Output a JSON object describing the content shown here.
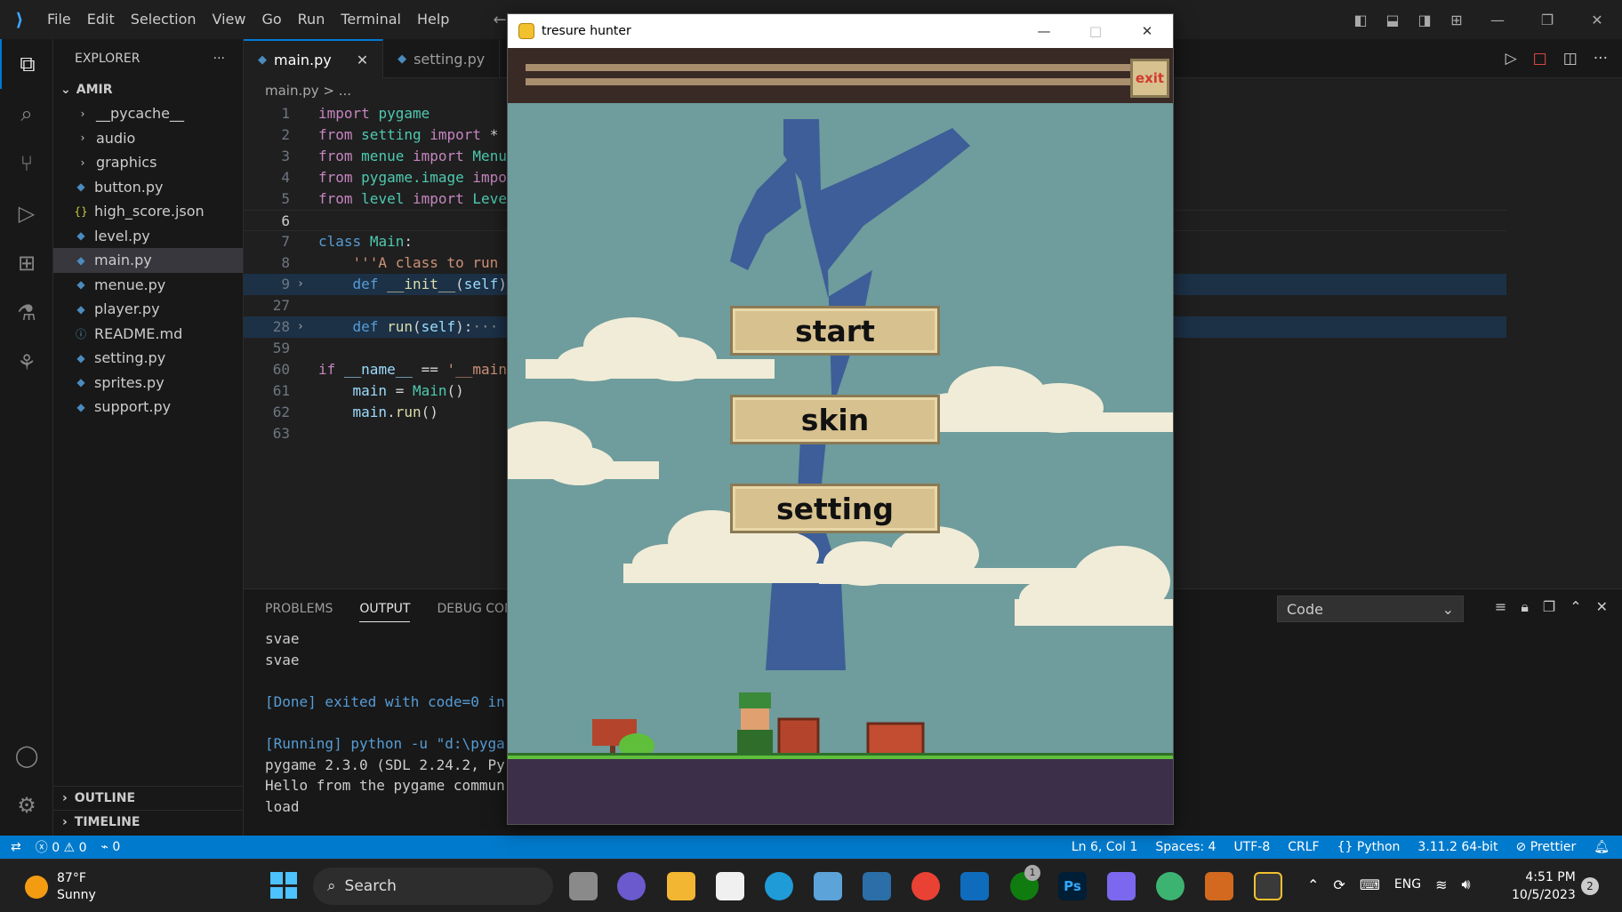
{
  "titlebar": {
    "menu": [
      "File",
      "Edit",
      "Selection",
      "View",
      "Go",
      "Run",
      "Terminal",
      "Help"
    ]
  },
  "sidebar": {
    "title": "EXPLORER",
    "more": "···",
    "root": "AMIR",
    "items": [
      {
        "label": "__pycache__",
        "type": "folder"
      },
      {
        "label": "audio",
        "type": "folder"
      },
      {
        "label": "graphics",
        "type": "folder"
      },
      {
        "label": "button.py",
        "type": "py"
      },
      {
        "label": "high_score.json",
        "type": "json"
      },
      {
        "label": "level.py",
        "type": "py"
      },
      {
        "label": "main.py",
        "type": "py",
        "selected": true
      },
      {
        "label": "menue.py",
        "type": "py"
      },
      {
        "label": "player.py",
        "type": "py"
      },
      {
        "label": "README.md",
        "type": "info"
      },
      {
        "label": "setting.py",
        "type": "py"
      },
      {
        "label": "sprites.py",
        "type": "py"
      },
      {
        "label": "support.py",
        "type": "py"
      }
    ],
    "outline": "OUTLINE",
    "timeline": "TIMELINE"
  },
  "editor": {
    "tabs": [
      {
        "label": "main.py",
        "active": true
      },
      {
        "label": "setting.py",
        "active": false
      }
    ],
    "breadcrumb": "main.py > ...",
    "lines": [
      {
        "n": "1",
        "code": "import pygame"
      },
      {
        "n": "2",
        "code": "from setting import *"
      },
      {
        "n": "3",
        "code": "from menue import Menu"
      },
      {
        "n": "4",
        "code": "from pygame.image impo"
      },
      {
        "n": "5",
        "code": "from level import Leve"
      },
      {
        "n": "6",
        "code": ""
      },
      {
        "n": "7",
        "code": "class Main:"
      },
      {
        "n": "8",
        "code": "    '''A class to run"
      },
      {
        "n": "9",
        "code": "    def __init__(self)"
      },
      {
        "n": "27",
        "code": ""
      },
      {
        "n": "28",
        "code": "    def run(self):···"
      },
      {
        "n": "59",
        "code": ""
      },
      {
        "n": "60",
        "code": "if __name__ == '__main"
      },
      {
        "n": "61",
        "code": "    main = Main()"
      },
      {
        "n": "62",
        "code": "    main.run()"
      },
      {
        "n": "63",
        "code": ""
      }
    ]
  },
  "panel": {
    "tabs": [
      "PROBLEMS",
      "OUTPUT",
      "DEBUG CONSO"
    ],
    "selector": "Code",
    "output": [
      "svae",
      "svae",
      "",
      "[Done] exited with code=0 in",
      "",
      "[Running] python -u \"d:\\pyga",
      "pygame 2.3.0 (SDL 2.24.2, Py",
      "Hello from the pygame commun",
      "load"
    ]
  },
  "status": {
    "errors": "0",
    "warnings": "0",
    "ports": "0",
    "position": "Ln 6, Col 1",
    "spaces": "Spaces: 4",
    "encoding": "UTF-8",
    "eol": "CRLF",
    "language": "Python",
    "interpreter": "3.11.2 64-bit",
    "formatter": "Prettier"
  },
  "game": {
    "title": "tresure hunter",
    "exit": "exit",
    "buttons": [
      "start",
      "skin",
      "setting"
    ]
  },
  "taskbar": {
    "temp": "87°F",
    "weather": "Sunny",
    "search": "Search",
    "lang": "ENG",
    "time": "4:51 PM",
    "date": "10/5/2023",
    "notifications": "2",
    "xbox_badge": "1"
  }
}
